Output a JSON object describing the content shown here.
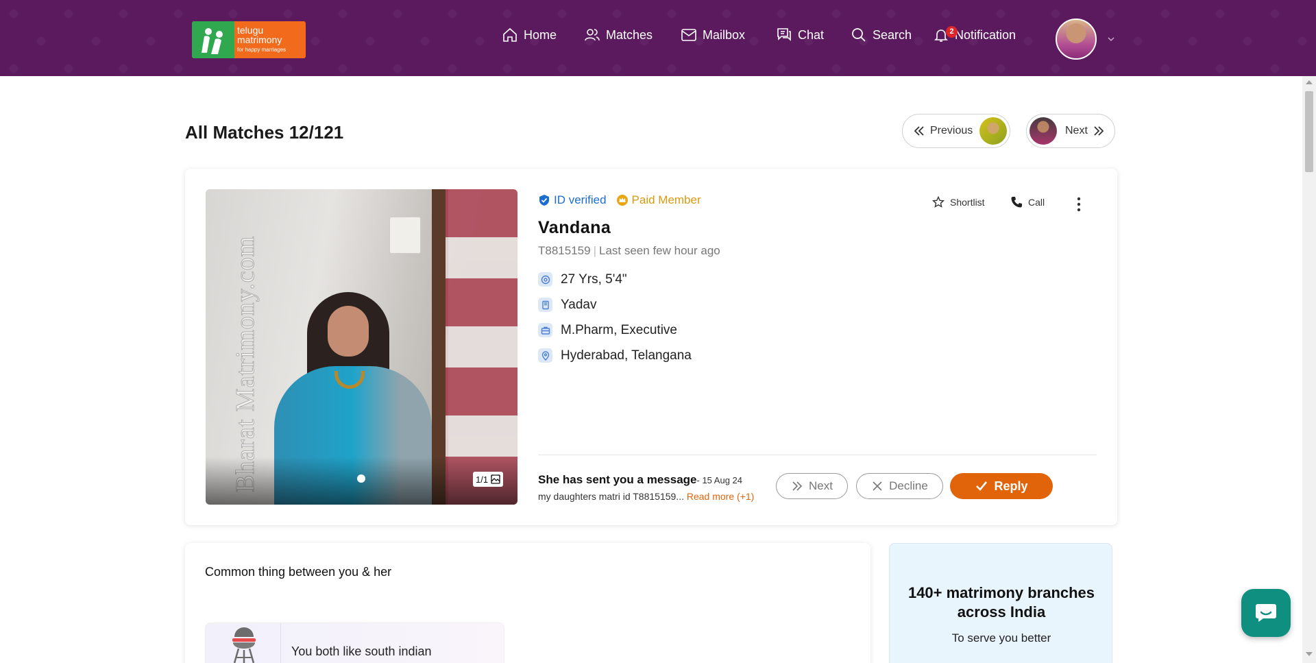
{
  "brand": {
    "line1": "telugu",
    "line2": "matrimony",
    "tagline": "for happy marriages",
    "colors": {
      "header_bg": "#5b1a5e",
      "logo_orange": "#f26b1d",
      "logo_green": "#2fa84f",
      "accent": "#e2640a",
      "verified_blue": "#1b6ecf",
      "paid_gold": "#d99a10"
    }
  },
  "nav": {
    "home": "Home",
    "matches": "Matches",
    "mailbox": "Mailbox",
    "chat": "Chat",
    "search": "Search",
    "notification": "Notification",
    "notification_count": "2"
  },
  "page": {
    "title": "All Matches 12/121",
    "previous_label": "Previous",
    "next_label": "Next"
  },
  "profile": {
    "id_verified": "ID verified",
    "paid_member": "Paid Member",
    "shortlist": "Shortlist",
    "call": "Call",
    "name": "Vandana",
    "matri_id": "T8815159",
    "last_seen": "Last seen few hour ago",
    "age_height": "27 Yrs, 5'4\"",
    "caste": "Yadav",
    "education_job": "M.Pharm, Executive",
    "location": "Hyderabad, Telangana",
    "photo_counter": "1/1",
    "photo_watermark": "Bharat Matrimony.com"
  },
  "message": {
    "title": "She has sent you a message",
    "date": "- 15 Aug 24",
    "body": "my daughters matri id T8815159...",
    "read_more": "Read more (+1)",
    "next_label": "Next",
    "decline_label": "Decline",
    "reply_label": "Reply"
  },
  "common": {
    "title": "Common thing between you & her",
    "item_text": "You both like south indian"
  },
  "branches": {
    "title": "140+ matrimony branches across India",
    "subtitle": "To serve you better"
  }
}
